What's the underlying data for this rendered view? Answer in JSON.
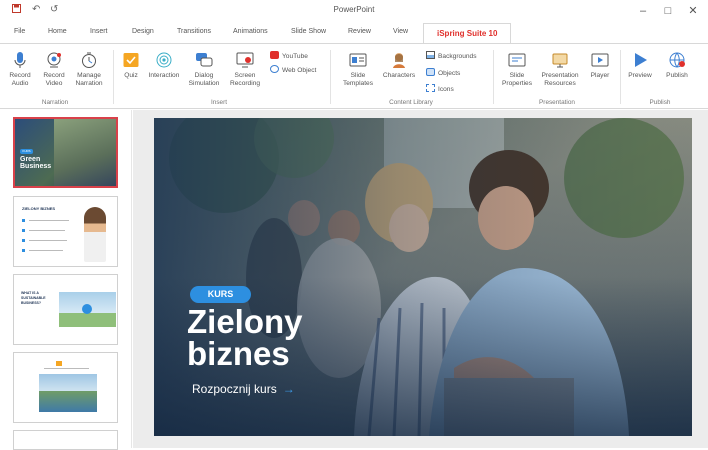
{
  "app": {
    "title": "PowerPoint"
  },
  "window_controls": {
    "minimize": "–",
    "maximize": "□",
    "close": "✕"
  },
  "quick_access": {
    "undo": "↶",
    "redo": "↺"
  },
  "tabs": [
    "File",
    "Home",
    "Insert",
    "Design",
    "Transitions",
    "Animations",
    "Slide Show",
    "Review",
    "View",
    "iSpring Suite 10"
  ],
  "ribbon": {
    "narration": {
      "record_audio": "Record Audio",
      "record_video": "Record Video",
      "manage_narration": "Manage Narration",
      "label": "Narration"
    },
    "insert": {
      "quiz": "Quiz",
      "interaction": "Interaction",
      "dialog_simulation": "Dialog Simulation",
      "screen_recording": "Screen Recording",
      "youtube": "YouTube",
      "web_object": "Web Object",
      "label": "Insert"
    },
    "content_library": {
      "slide_templates": "Slide Templates",
      "characters": "Characters",
      "backgrounds": "Backgrounds",
      "objects": "Objects",
      "icons": "Icons",
      "label": "Content Library"
    },
    "presentation": {
      "slide_properties": "Slide Properties",
      "presentation_resources": "Presentation Resources",
      "player": "Player",
      "label": "Presentation"
    },
    "publish": {
      "preview": "Preview",
      "publish": "Publish",
      "label": "Publish"
    }
  },
  "thumbnails": {
    "t1": {
      "badge": "KURS",
      "title": "Green Business"
    },
    "t2": {
      "title": "ZIELONY BIZNES"
    },
    "t3": {
      "title": "WHAT IS A SUSTAINABLE BUSINESS?"
    }
  },
  "slide": {
    "badge": "KURS",
    "title_line1": "Zielony",
    "title_line2": "biznes",
    "cta": "Rozpocznij kurs",
    "cta_arrow": "→"
  },
  "colors": {
    "accent": "#e0302c",
    "badge_blue": "#2d8fe0",
    "selection": "#d9414a"
  }
}
